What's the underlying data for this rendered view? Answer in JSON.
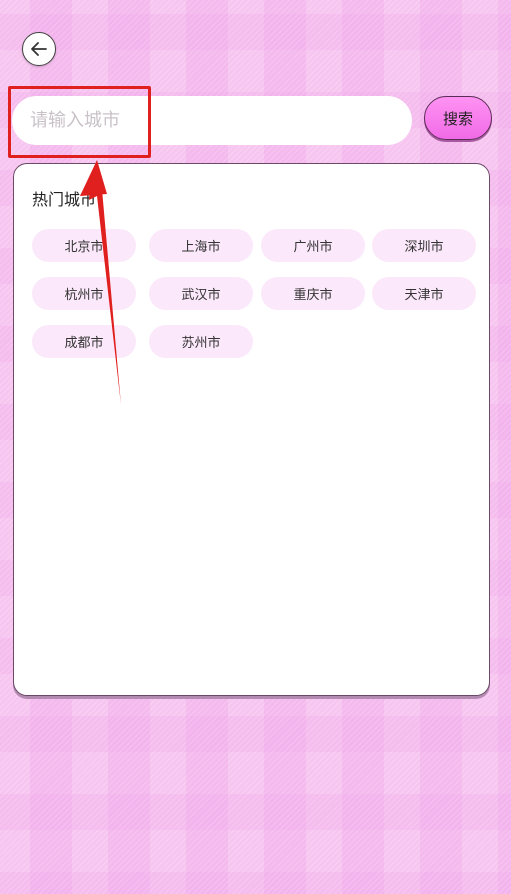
{
  "header": {
    "back_icon": "arrow-left-icon"
  },
  "search": {
    "placeholder": "请输入城市",
    "button_label": "搜索"
  },
  "hot_cities": {
    "title": "热门城市",
    "items": [
      "北京市",
      "上海市",
      "广州市",
      "深圳市",
      "杭州市",
      "武汉市",
      "重庆市",
      "天津市",
      "成都市",
      "苏州市"
    ]
  },
  "colors": {
    "background": "#f7c6f0",
    "chip": "#fbe8fa",
    "search_button": "#f06be6",
    "annotation": "#e0201f"
  }
}
